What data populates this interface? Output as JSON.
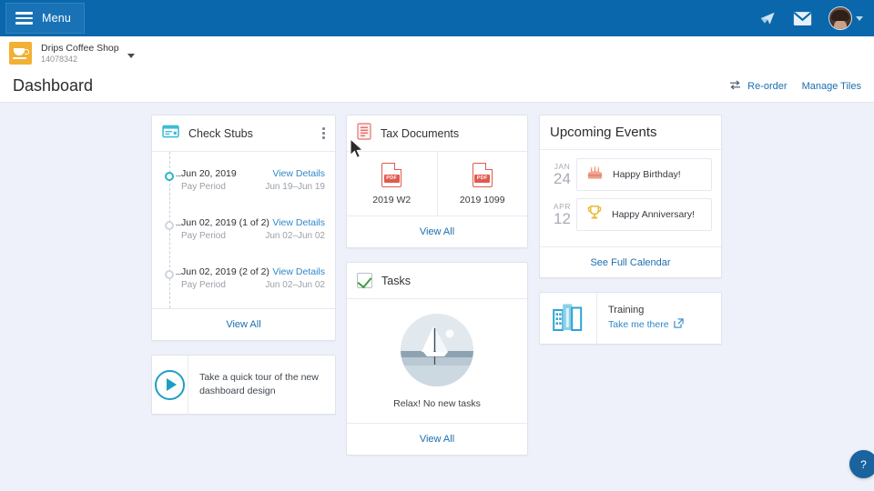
{
  "topbar": {
    "menu_label": "Menu",
    "icons": [
      "send-icon",
      "mail-icon",
      "avatar"
    ]
  },
  "company": {
    "name": "Drips Coffee Shop",
    "id": "14078342"
  },
  "header": {
    "page_title": "Dashboard",
    "reorder_label": "Re-order",
    "manage_tiles_label": "Manage Tiles"
  },
  "check_stubs": {
    "title": "Check Stubs",
    "view_all": "View All",
    "rows": [
      {
        "date": "Jun 20, 2019",
        "action": "View Details",
        "label": "Pay Period",
        "period": "Jun 19–Jun 19",
        "active": true
      },
      {
        "date": "Jun 02, 2019 (1 of 2)",
        "action": "View Details",
        "label": "Pay Period",
        "period": "Jun 02–Jun 02",
        "active": false
      },
      {
        "date": "Jun 02, 2019 (2 of 2)",
        "action": "View Details",
        "label": "Pay Period",
        "period": "Jun 02–Jun 02",
        "active": false
      }
    ]
  },
  "tour": {
    "text": "Take a quick tour of the new dashboard design"
  },
  "tax_documents": {
    "title": "Tax Documents",
    "view_all": "View All",
    "docs": [
      {
        "name": "2019 W2",
        "type": "PDF"
      },
      {
        "name": "2019 1099",
        "type": "PDF"
      }
    ]
  },
  "tasks": {
    "title": "Tasks",
    "empty_message": "Relax! No new tasks",
    "view_all": "View All"
  },
  "upcoming_events": {
    "title": "Upcoming Events",
    "see_full_calendar": "See Full Calendar",
    "events": [
      {
        "month": "JAN",
        "day": "24",
        "label": "Happy Birthday!",
        "icon": "cake-icon"
      },
      {
        "month": "APR",
        "day": "12",
        "label": "Happy Anniversary!",
        "icon": "trophy-icon"
      }
    ]
  },
  "training": {
    "title": "Training",
    "link_label": "Take me there"
  },
  "help": {
    "label": "?"
  },
  "colors": {
    "brand_blue": "#0a67ab",
    "link_blue": "#2f87c9",
    "page_bg": "#eef1f9",
    "accent_teal": "#27b5c9",
    "pdf_red": "#e05a4f",
    "logo_yellow": "#f2b134"
  }
}
